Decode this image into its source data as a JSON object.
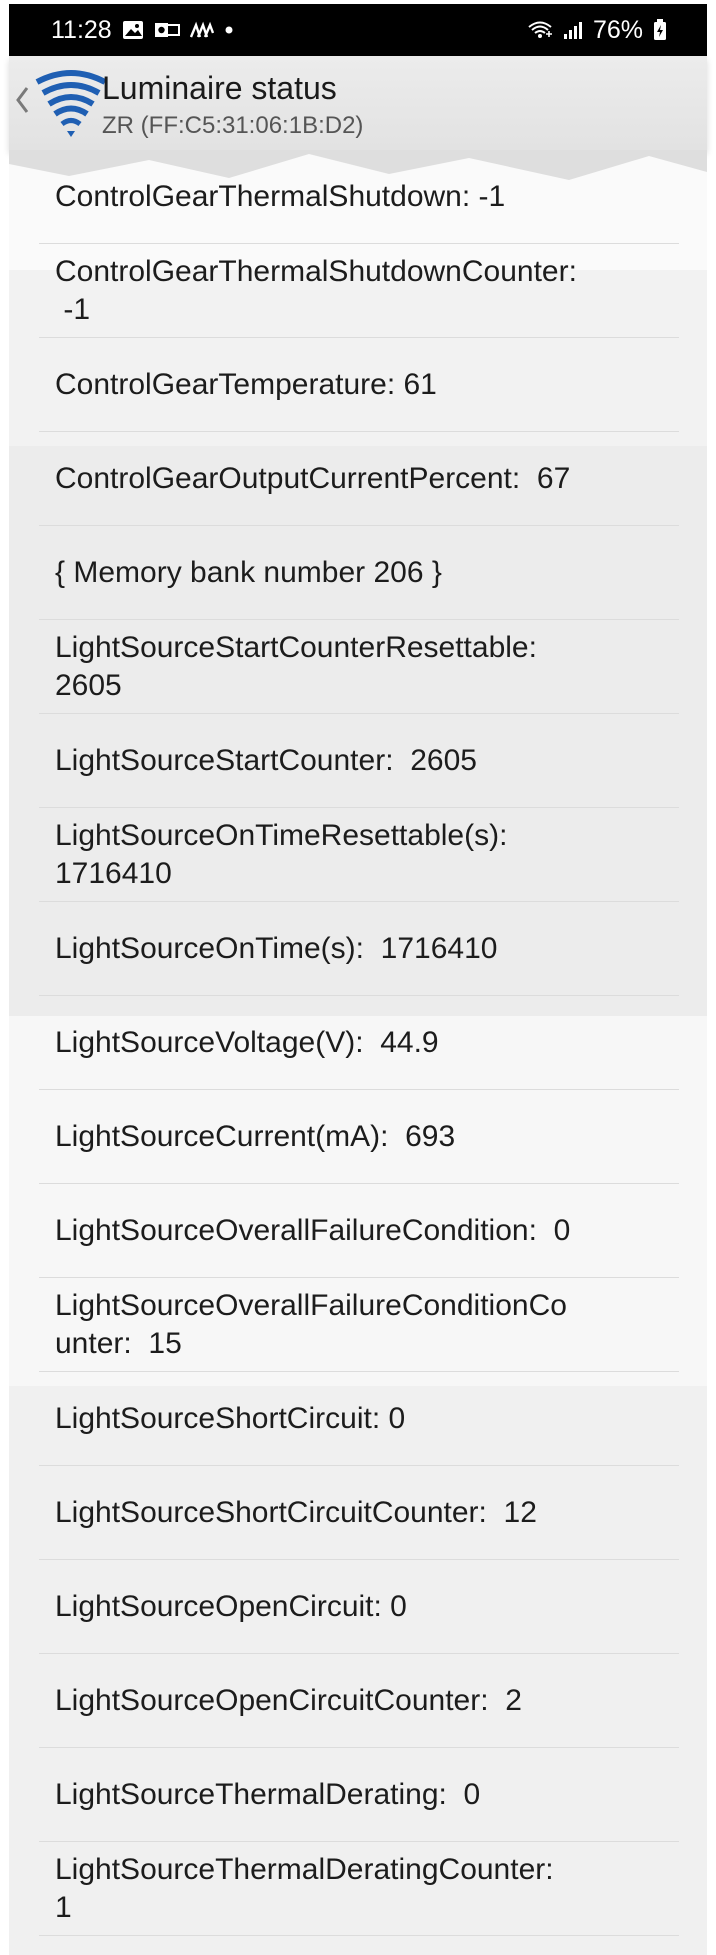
{
  "status_bar": {
    "time": "11:28",
    "battery": "76%",
    "left_icons": [
      "gallery-icon",
      "outlook-icon",
      "activity-icon",
      "dot-icon"
    ],
    "right_icons": [
      "wifi-call-icon",
      "signal-icon",
      "battery-icon"
    ]
  },
  "app_bar": {
    "title": "Luminaire status",
    "subtitle": "ZR (FF:C5:31:06:1B:D2)",
    "logo_color": "#1f5fb3"
  },
  "rows": [
    {
      "text": "ControlGearThermalShutdown: -1"
    },
    {
      "text": "ControlGearThermalShutdownCounter:\n -1"
    },
    {
      "text": "ControlGearTemperature: 61"
    },
    {
      "text": "ControlGearOutputCurrentPercent:  67"
    },
    {
      "text": "{ Memory bank number 206 }"
    },
    {
      "text": "LightSourceStartCounterResettable:\n2605"
    },
    {
      "text": "LightSourceStartCounter:  2605"
    },
    {
      "text": "LightSourceOnTimeResettable(s):\n1716410"
    },
    {
      "text": "LightSourceOnTime(s):  1716410"
    },
    {
      "text": "LightSourceVoltage(V):  44.9"
    },
    {
      "text": "LightSourceCurrent(mA):  693"
    },
    {
      "text": "LightSourceOverallFailureCondition:  0"
    },
    {
      "text": "LightSourceOverallFailureConditionCo\nunter:  15"
    },
    {
      "text": "LightSourceShortCircuit: 0"
    },
    {
      "text": "LightSourceShortCircuitCounter:  12"
    },
    {
      "text": "LightSourceOpenCircuit: 0"
    },
    {
      "text": "LightSourceOpenCircuitCounter:  2"
    },
    {
      "text": "LightSourceThermalDerating:  0"
    },
    {
      "text": "LightSourceThermalDeratingCounter:\n1"
    }
  ]
}
